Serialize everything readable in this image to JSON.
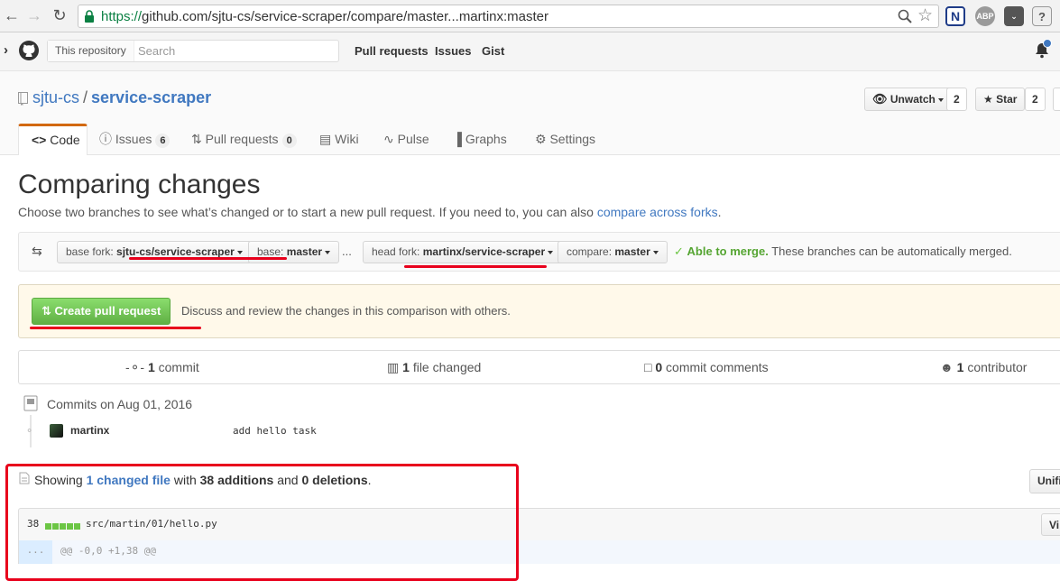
{
  "browser": {
    "url_scheme": "https://",
    "url_rest": "github.com/sjtu-cs/service-scraper/compare/master...martinx:master",
    "ext_abp": "ABP"
  },
  "header": {
    "scope_label": "This repository",
    "search_placeholder": "Search",
    "nav": [
      "Pull requests",
      "Issues",
      "Gist"
    ]
  },
  "repo": {
    "owner": "sjtu-cs",
    "separator": "/",
    "name": "service-scraper",
    "unwatch_label": "Unwatch",
    "watch_count": "2",
    "star_label": "Star",
    "star_count": "2"
  },
  "tabs": {
    "code": "Code",
    "issues": "Issues",
    "issues_count": "6",
    "pulls": "Pull requests",
    "pulls_count": "0",
    "wiki": "Wiki",
    "pulse": "Pulse",
    "graphs": "Graphs",
    "settings": "Settings"
  },
  "compare": {
    "title": "Comparing changes",
    "subtitle": "Choose two branches to see what’s changed or to start a new pull request. If you need to, you can also",
    "subtitle_link": "compare across forks",
    "subtitle_end": ".",
    "base_fork_label": "base fork:",
    "base_fork_value": "sjtu-cs/service-scraper",
    "base_label": "base:",
    "base_value": "master",
    "dots": "...",
    "head_fork_label": "head fork:",
    "head_fork_value": "martinx/service-scraper",
    "compare_label": "compare:",
    "compare_value": "master",
    "merge_status": "Able to merge.",
    "merge_text": "These branches can be automatically merged.",
    "create_pr": "Create pull request",
    "create_pr_text": "Discuss and review the changes in this comparison with others.",
    "accent_color": "#6cc644",
    "highlight_color": "#e8001c"
  },
  "summary": {
    "commits_count": "1",
    "commits_label": "commit",
    "files_count": "1",
    "files_label": "file changed",
    "comments_count": "0",
    "comments_label": "commit comments",
    "contributors_count": "1",
    "contributors_label": "contributor"
  },
  "commits": {
    "group_title": "Commits on Aug 01, 2016",
    "items": [
      {
        "author": "martinx",
        "message": "add hello task"
      }
    ]
  },
  "files": {
    "showing": "Showing",
    "changed_link": "1 changed file",
    "with": "with",
    "additions": "38 additions",
    "and": "and",
    "deletions": "0 deletions",
    "period": ".",
    "unified_button": "Unifi",
    "file_changes": "38",
    "file_path": "src/martin/01/hello.py",
    "view_button": "Vi",
    "hunk_expander": "...",
    "hunk_header": "@@ -0,0 +1,38 @@"
  }
}
